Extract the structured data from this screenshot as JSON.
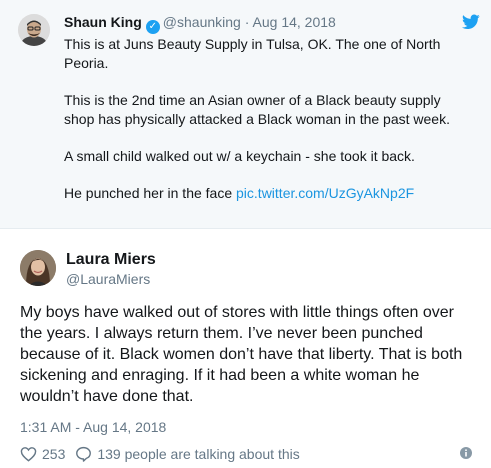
{
  "quoted_tweet": {
    "author_name": "Shaun King",
    "verified_glyph": "✓",
    "handle": "@shaunking",
    "separator": "·",
    "date": "Aug 14, 2018",
    "paragraphs": [
      "This is at Juns Beauty Supply in Tulsa, OK. The one of North Peoria.",
      "This is the 2nd time an Asian owner of a Black beauty supply shop has physically attacked a Black woman in the past week.",
      "A small child walked out w/ a keychain - she took it back."
    ],
    "last_line_text": "He punched her in the face ",
    "link_text": "pic.twitter.com/UzGyAkNp2F",
    "icons": [
      "twitter-bird-icon",
      "verified-badge-icon"
    ]
  },
  "reply_tweet": {
    "author_name": "Laura Miers",
    "handle": "@LauraMiers",
    "text": "My boys have walked out of stores with little things often over the years. I always return them. I’ve never been punched because of it. Black women don’t have that liberty. That is both sickening and enraging. If it had been a white woman he wouldn’t have done that.",
    "timestamp": "1:31 AM - Aug 14, 2018",
    "like_count": "253",
    "reply_summary": "139 people are talking about this",
    "icons": [
      "heart-icon",
      "reply-bubble-icon",
      "info-icon"
    ]
  },
  "colors": {
    "quoted_background": "#f5f8fa",
    "link": "#1b95e0",
    "verified": "#1da1f2",
    "muted_text": "#657786",
    "text": "#14171a"
  }
}
